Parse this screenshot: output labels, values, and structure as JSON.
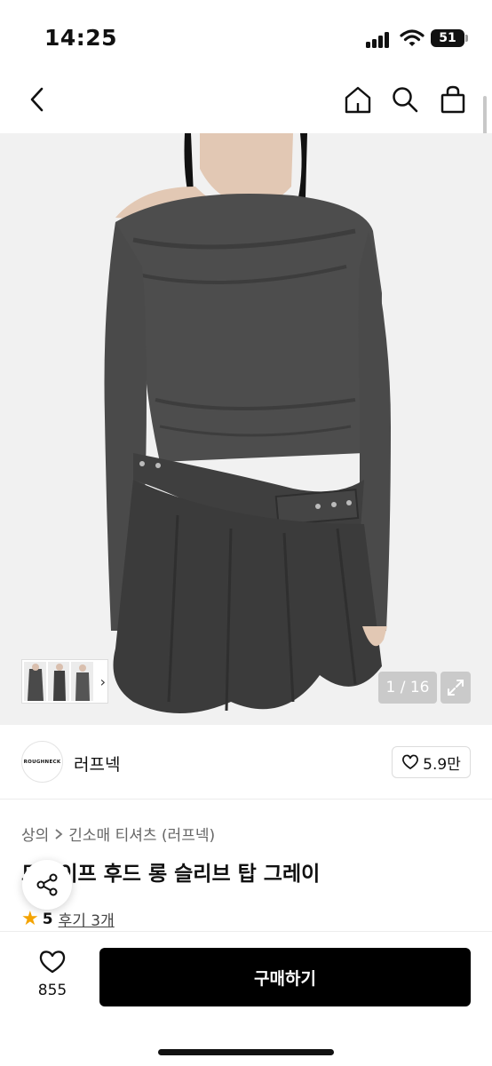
{
  "status": {
    "time": "14:25",
    "battery": "51"
  },
  "nav": {
    "back_icon": "chevron-left-icon",
    "home_icon": "home-icon",
    "search_icon": "search-icon",
    "cart_icon": "shopping-bag-icon"
  },
  "gallery": {
    "counter": "1 / 16",
    "expand_icon": "expand-icon",
    "thumb_chevron": "›"
  },
  "brand": {
    "logo_text": "ROUGHNECK",
    "name": "러프넥",
    "likes": "5.9만"
  },
  "breadcrumb": {
    "category": "상의",
    "subcategory": "긴소매 티셔츠 (러프넥)"
  },
  "product": {
    "title": "드레이프 후드 롱 슬리브 탑 그레이",
    "rating": "5",
    "reviews_label": "후기 3개"
  },
  "bottom": {
    "wish_count": "855",
    "buy_label": "구매하기"
  },
  "colors": {
    "accent": "#000000",
    "star": "#f4a300",
    "garment": "#4a4a4a"
  }
}
